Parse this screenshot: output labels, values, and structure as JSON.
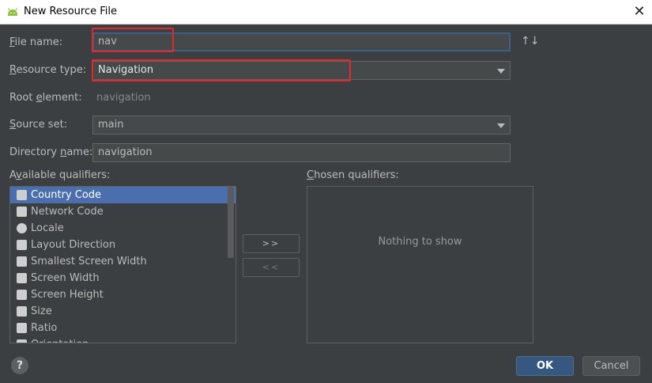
{
  "window": {
    "title": "New Resource File",
    "close_glyph": "✕",
    "app_icon": "android-icon"
  },
  "form": {
    "file_name": {
      "label_mnemonic": "F",
      "label_rest": "ile name:",
      "value": "nav"
    },
    "sort_glyph": "↑↓",
    "resource_type": {
      "label_mnemonic": "R",
      "label_rest": "esource type:",
      "value": "Navigation"
    },
    "root_element": {
      "label_pre": "Root ",
      "label_mnemonic": "e",
      "label_rest": "lement:",
      "value": "navigation"
    },
    "source_set": {
      "label_mnemonic": "S",
      "label_rest": "ource set:",
      "value": "main"
    },
    "directory_name": {
      "label_pre": "Directory ",
      "label_mnemonic": "n",
      "label_rest": "ame:",
      "value": "navigation"
    }
  },
  "available": {
    "label_pre": "A",
    "label_mnemonic": "v",
    "label_rest": "ailable qualifiers:",
    "items": [
      {
        "label": "Country Code",
        "icon": "country-code-icon"
      },
      {
        "label": "Network Code",
        "icon": "network-code-icon"
      },
      {
        "label": "Locale",
        "icon": "globe-icon"
      },
      {
        "label": "Layout Direction",
        "icon": "layout-direction-icon"
      },
      {
        "label": "Smallest Screen Width",
        "icon": "smallest-screen-width-icon"
      },
      {
        "label": "Screen Width",
        "icon": "screen-width-icon"
      },
      {
        "label": "Screen Height",
        "icon": "screen-height-icon"
      },
      {
        "label": "Size",
        "icon": "size-icon"
      },
      {
        "label": "Ratio",
        "icon": "ratio-icon"
      },
      {
        "label": "Orientation",
        "icon": "orientation-icon"
      }
    ]
  },
  "move_buttons": {
    "add": ">>",
    "remove": "<<"
  },
  "chosen": {
    "label_mnemonic": "C",
    "label_rest": "hosen qualifiers:",
    "empty_text": "Nothing to show"
  },
  "footer": {
    "help": "?",
    "ok": "OK",
    "cancel": "Cancel"
  },
  "colors": {
    "background": "#3c3f41",
    "selection": "#4b6eaf",
    "accent": "#365880",
    "highlight_box": "#e8272b"
  }
}
